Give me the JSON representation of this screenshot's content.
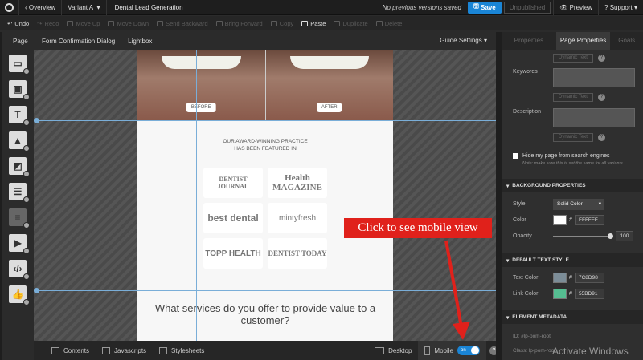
{
  "topbar": {
    "overview": "Overview",
    "variant": "Variant A",
    "title": "Dental Lead Generation",
    "status": "No previous versions saved",
    "save": "Save",
    "unpublished": "Unpublished",
    "preview": "Preview",
    "support": "Support"
  },
  "toolbar": {
    "undo": "Undo",
    "redo": "Redo",
    "move_up": "Move Up",
    "move_down": "Move Down",
    "send_backward": "Send Backward",
    "bring_forward": "Bring Forward",
    "copy": "Copy",
    "paste": "Paste",
    "duplicate": "Duplicate",
    "delete": "Delete"
  },
  "subtabs": {
    "page": "Page",
    "confirmation": "Form Confirmation Dialog",
    "lightbox": "Lightbox",
    "guide": "Guide Settings ▾"
  },
  "canvas": {
    "before": "BEFORE",
    "after": "AFTER",
    "featured_line1": "OUR AWARD-WINNING PRACTICE",
    "featured_line2": "HAS BEEN FEATURED IN",
    "logos": [
      "DENTIST JOURNAL",
      "Health MAGAZINE",
      "best dental",
      "mintyfresh",
      "TOPP HEALTH",
      "DENTIST TODAY"
    ],
    "question": "What services do you offer to provide value to a customer?"
  },
  "bottombar": {
    "contents": "Contents",
    "javascripts": "Javascripts",
    "stylesheets": "Stylesheets",
    "desktop": "Desktop",
    "mobile": "Mobile",
    "toggle": "on"
  },
  "rpanel": {
    "tabs": [
      "Properties",
      "Page Properties",
      "Goals"
    ],
    "dynamic": "Dynamic Text",
    "keywords": "Keywords",
    "description": "Description",
    "hide_label": "Hide my page from search engines",
    "hide_note": "Note: make sure this is set the same for all variants",
    "bg_section": "BACKGROUND PROPERTIES",
    "style_label": "Style",
    "style_value": "Solid Color",
    "color_label": "Color",
    "color_hex": "FFFFFF",
    "opacity_label": "Opacity",
    "opacity_value": "100",
    "text_section": "DEFAULT TEXT STYLE",
    "text_color_label": "Text Color",
    "text_color_hex": "7C8D98",
    "link_color_label": "Link Color",
    "link_color_hex": "55BD91",
    "meta_section": "ELEMENT METADATA",
    "id_line": "ID:  #lp-pom-root",
    "class_line": "Class:  lp-pom-root"
  },
  "annotation": "Click to see mobile view",
  "watermark": "Activate Windows",
  "colors": {
    "accent": "#1a85d6",
    "text_swatch": "#7C8D98",
    "link_swatch": "#55BD91",
    "callout": "#e0211b"
  }
}
